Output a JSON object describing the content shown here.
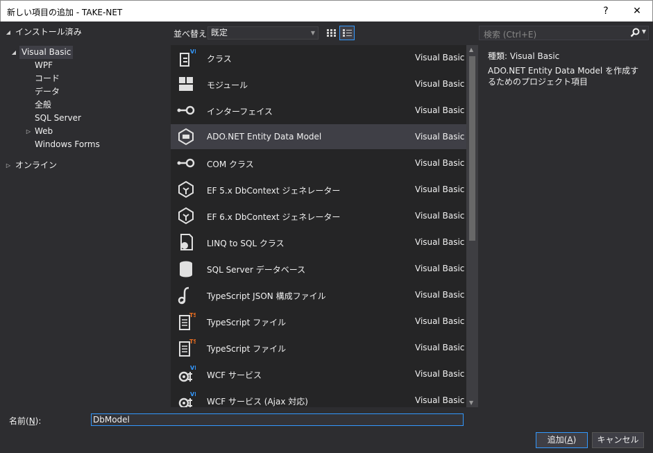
{
  "window": {
    "title": "新しい項目の追加 - TAKE-NET",
    "help": "?",
    "close": "✕"
  },
  "tree": {
    "installed": "インストール済み",
    "visual_basic": "Visual Basic",
    "children": [
      "WPF",
      "コード",
      "データ",
      "全般",
      "SQL Server",
      "Web",
      "Windows Forms"
    ],
    "online": "オンライン"
  },
  "toolbar": {
    "sort_label": "並べ替え:",
    "sort_value": "既定"
  },
  "search": {
    "placeholder": "検索 (Ctrl+E)"
  },
  "items": [
    {
      "name": "クラス",
      "lang": "Visual Basic",
      "icon": "vb-class-icon"
    },
    {
      "name": "モジュール",
      "lang": "Visual Basic",
      "icon": "module-icon"
    },
    {
      "name": "インターフェイス",
      "lang": "Visual Basic",
      "icon": "interface-icon"
    },
    {
      "name": "ADO.NET Entity Data Model",
      "lang": "Visual Basic",
      "icon": "entity-model-icon"
    },
    {
      "name": "COM クラス",
      "lang": "Visual Basic",
      "icon": "com-class-icon"
    },
    {
      "name": "EF 5.x DbContext ジェネレーター",
      "lang": "Visual Basic",
      "icon": "ef-generator-icon"
    },
    {
      "name": "EF 6.x DbContext ジェネレーター",
      "lang": "Visual Basic",
      "icon": "ef-generator-icon"
    },
    {
      "name": "LINQ to SQL クラス",
      "lang": "Visual Basic",
      "icon": "linq-icon"
    },
    {
      "name": "SQL Server データベース",
      "lang": "Visual Basic",
      "icon": "database-icon"
    },
    {
      "name": "TypeScript JSON 構成ファイル",
      "lang": "Visual Basic",
      "icon": "json-config-icon"
    },
    {
      "name": "TypeScript ファイル",
      "lang": "Visual Basic",
      "icon": "typescript-file-icon"
    },
    {
      "name": "TypeScript ファイル",
      "lang": "Visual Basic",
      "icon": "typescript-file-icon"
    },
    {
      "name": "WCF サービス",
      "lang": "Visual Basic",
      "icon": "wcf-service-icon"
    },
    {
      "name": "WCF サービス (Ajax 対応)",
      "lang": "Visual Basic",
      "icon": "wcf-service-icon"
    }
  ],
  "selected_index": 3,
  "detail": {
    "type_label": "種類:",
    "type_value": "Visual Basic",
    "description": "ADO.NET Entity Data Model を作成するためのプロジェクト項目"
  },
  "name_field": {
    "label": "名前(",
    "mnemonic": "N",
    "label_end": "):",
    "value": "DbModel"
  },
  "buttons": {
    "add": "追加(",
    "add_mnemonic": "A",
    "add_end": ")",
    "cancel": "キャンセル"
  },
  "colors": {
    "accent": "#3399ff",
    "background": "#2d2d30",
    "list_background": "#252526",
    "selection": "#3f3f46",
    "vb_badge": "#3399ff",
    "ts_badge": "#f07020"
  }
}
